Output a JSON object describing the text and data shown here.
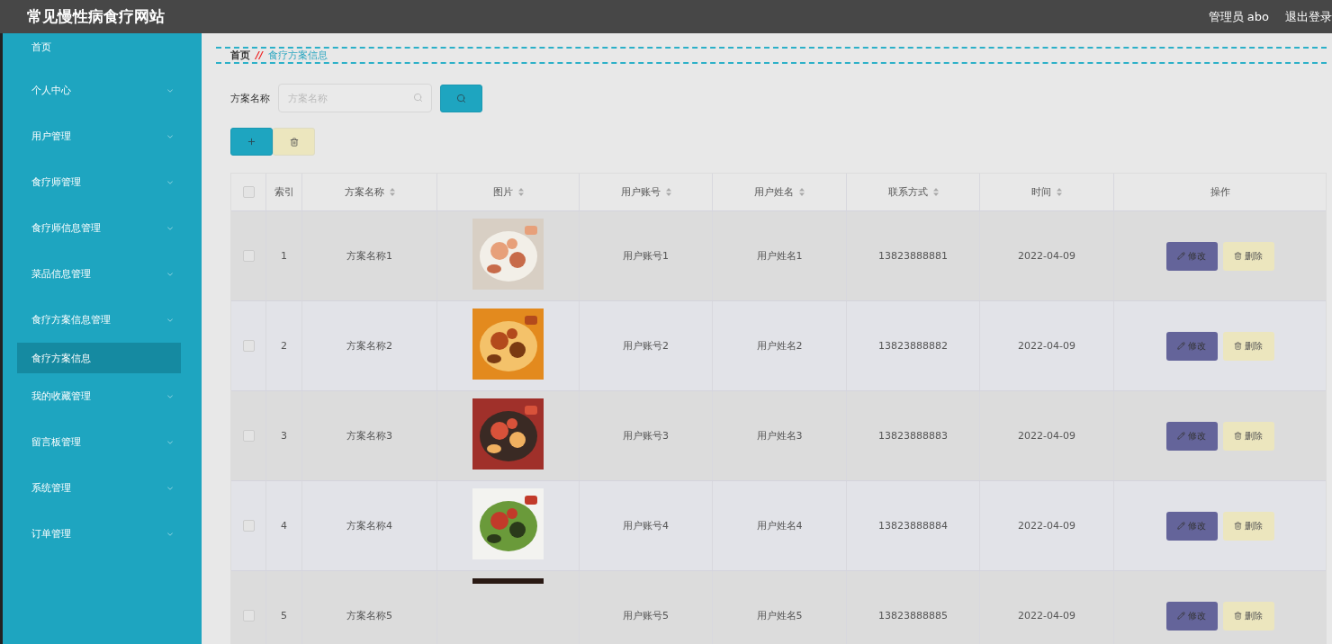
{
  "header": {
    "title": "常见慢性病食疗网站",
    "user": "管理员 abo",
    "logout": "退出登录"
  },
  "sidebar": {
    "items": [
      {
        "label": "首页",
        "expandable": false,
        "selected": false
      },
      {
        "label": "个人中心",
        "expandable": true,
        "selected": false
      },
      {
        "label": "用户管理",
        "expandable": true,
        "selected": false
      },
      {
        "label": "食疗师管理",
        "expandable": true,
        "selected": false
      },
      {
        "label": "食疗师信息管理",
        "expandable": true,
        "selected": false
      },
      {
        "label": "菜品信息管理",
        "expandable": true,
        "selected": false
      },
      {
        "label": "食疗方案信息管理",
        "expandable": true,
        "selected": false,
        "children": [
          {
            "label": "食疗方案信息",
            "selected": true
          }
        ]
      },
      {
        "label": "我的收藏管理",
        "expandable": true,
        "selected": false
      },
      {
        "label": "留言板管理",
        "expandable": true,
        "selected": false
      },
      {
        "label": "系统管理",
        "expandable": true,
        "selected": false
      },
      {
        "label": "订单管理",
        "expandable": true,
        "selected": false
      }
    ]
  },
  "breadcrumb": {
    "home": "首页",
    "separator": "//",
    "current": "食疗方案信息"
  },
  "search": {
    "label": "方案名称",
    "placeholder": "方案名称"
  },
  "table": {
    "all_checked": false,
    "columns": [
      {
        "label": "索引",
        "sortable": false
      },
      {
        "label": "方案名称",
        "sortable": true
      },
      {
        "label": "图片",
        "sortable": true
      },
      {
        "label": "用户账号",
        "sortable": true
      },
      {
        "label": "用户姓名",
        "sortable": true
      },
      {
        "label": "联系方式",
        "sortable": true
      },
      {
        "label": "时间",
        "sortable": true
      },
      {
        "label": "操作",
        "sortable": false
      }
    ],
    "rows": [
      {
        "checked": false,
        "index": "1",
        "name": "方案名称1",
        "account": "用户账号1",
        "username": "用户姓名1",
        "phone": "13823888881",
        "date": "2022-04-09",
        "edit": "修改",
        "delete": "删除"
      },
      {
        "checked": false,
        "index": "2",
        "name": "方案名称2",
        "account": "用户账号2",
        "username": "用户姓名2",
        "phone": "13823888882",
        "date": "2022-04-09",
        "edit": "修改",
        "delete": "删除"
      },
      {
        "checked": false,
        "index": "3",
        "name": "方案名称3",
        "account": "用户账号3",
        "username": "用户姓名3",
        "phone": "13823888883",
        "date": "2022-04-09",
        "edit": "修改",
        "delete": "删除"
      },
      {
        "checked": false,
        "index": "4",
        "name": "方案名称4",
        "account": "用户账号4",
        "username": "用户姓名4",
        "phone": "13823888884",
        "date": "2022-04-09",
        "edit": "修改",
        "delete": "删除"
      },
      {
        "checked": false,
        "index": "5",
        "name": "方案名称5",
        "account": "用户账号5",
        "username": "用户姓名5",
        "phone": "13823888885",
        "date": "2022-04-09",
        "edit": "修改",
        "delete": "删除"
      }
    ]
  }
}
